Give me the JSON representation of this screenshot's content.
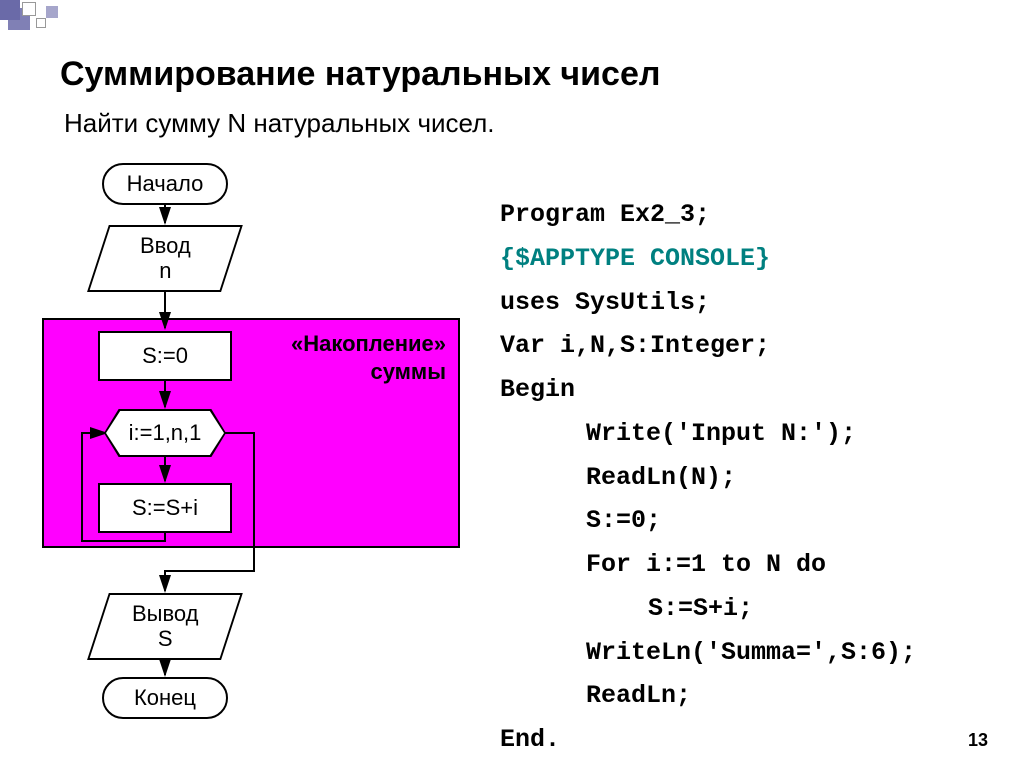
{
  "title": "Суммирование натуральных чисел",
  "subtitle": "Найти сумму N натуральных чисел.",
  "page_number": "13",
  "flowchart": {
    "start": "Начало",
    "input": "Ввод\nn",
    "init": "S:=0",
    "loop": "i:=1,n,1",
    "accum": "S:=S+i",
    "output": "Вывод\nS",
    "end": "Конец",
    "box_label_1": "«Накопление»",
    "box_label_2": "суммы"
  },
  "code": {
    "l1": "Program Ex2_3;",
    "l2": "{$APPTYPE CONSOLE}",
    "l3": "uses  SysUtils;",
    "l4": "Var i,N,S:Integer;",
    "l5": "Begin",
    "l6": "Write('Input N:');",
    "l7": "ReadLn(N);",
    "l8": "S:=0;",
    "l9": "For i:=1 to N do",
    "l10": "S:=S+i;",
    "l11": "WriteLn('Summa=',S:6);",
    "l12": "ReadLn;",
    "l13": "End."
  }
}
